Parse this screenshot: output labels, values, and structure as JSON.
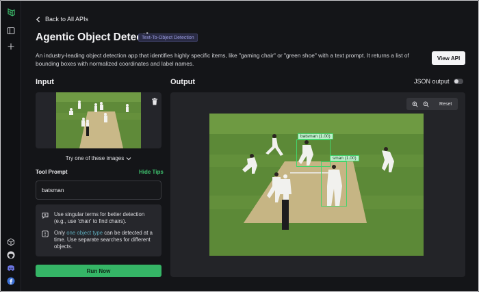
{
  "nav": {
    "back_label": "Back to All APIs"
  },
  "header": {
    "title": "Agentic Object Detection",
    "tag": "Text-To-Object Detection",
    "description": "An industry-leading object detection app that identifies highly specific items, like \"gaming chair\" or \"green shoe\" with a text prompt. It returns a list of bounding boxes with normalized coordinates and label names.",
    "view_api_label": "View API"
  },
  "input": {
    "heading": "Input",
    "try_images_label": "Try one of these images",
    "tool_prompt_label": "Tool Prompt",
    "hide_tips_label": "Hide Tips",
    "prompt_value": "batsman",
    "tips": [
      {
        "icon": "message-plus-icon",
        "text": "Use singular terms for better detection (e.g., use 'chair' to find chairs)."
      },
      {
        "icon": "alert-icon",
        "text_before": "Only ",
        "link": "one object type",
        "text_after": " can be detected at a time. Use separate searches for different objects."
      }
    ],
    "run_label": "Run Now"
  },
  "output": {
    "heading": "Output",
    "json_toggle_label": "JSON output",
    "json_toggle_on": false,
    "reset_label": "Reset",
    "detections": [
      {
        "label": "batsman (1.00)"
      },
      {
        "label": "sman (1.00)"
      }
    ]
  },
  "colors": {
    "accent_green": "#35b566",
    "box_green": "#43d46b",
    "tag_purple": "#9a9ce0",
    "link_teal": "#5ca8b8"
  },
  "icons": [
    "logo-icon",
    "sidebar-panel-icon",
    "plus-icon",
    "cube-icon",
    "github-icon",
    "discord-icon",
    "facebook-icon",
    "chevron-left-icon",
    "trash-icon",
    "chevron-down-icon",
    "zoom-in-icon",
    "zoom-out-icon"
  ]
}
